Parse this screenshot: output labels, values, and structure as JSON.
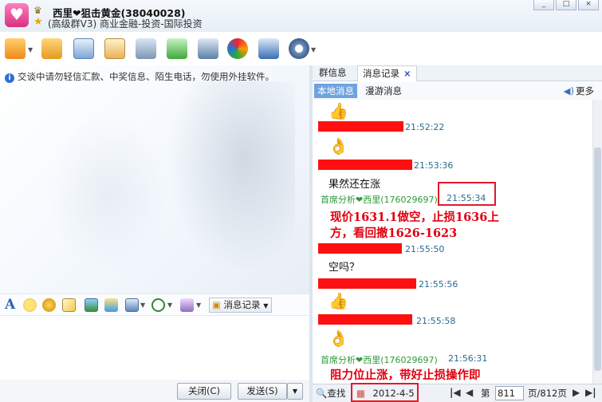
{
  "window": {
    "group_name": "西里❤狙击黄金(38040028)",
    "group_sub": "(高级群V3) 商业金融-投资-国际投资",
    "controls": [
      "_",
      "□",
      "×"
    ]
  },
  "toolbar": {
    "icons": [
      "home-icon",
      "folder-icon",
      "document-icon",
      "photo-album-icon",
      "game-icon",
      "add-app-icon",
      "tools-icon",
      "sync-icon",
      "settings-person-icon",
      "gear-icon"
    ]
  },
  "left": {
    "notice": "交谈中请勿轻信汇款、中奖信息、陌生电话，勿使用外挂软件。",
    "notice_icon": "i",
    "font_glyph": "A",
    "message_record_label": "消息记录",
    "close_label": "关闭(C)",
    "send_label": "发送(S)"
  },
  "right": {
    "tabs": [
      "群信息",
      "消息记录"
    ],
    "tab_close": "×",
    "subtabs": [
      "本地消息",
      "漫游消息"
    ],
    "more_label": "更多",
    "messages": {
      "t1": "21:52:22",
      "t2": "21:53:36",
      "m1": "果然还在涨",
      "sender1": "首席分析❤西里(176029697)",
      "t3": "21:55:34",
      "annotation1_line1": "现价1631.1做空，止损1636上",
      "annotation1_line2": "方，看回撤1626-1623",
      "t4": "21:55:50",
      "m2": "空吗？",
      "t5": "21:55:56",
      "t6": "21:55:58",
      "sender2": "首席分析❤西里(176029697)",
      "t7": "21:56:31",
      "annotation2": "阻力位止涨，带好止损操作即"
    },
    "footer": {
      "find_label": "查找",
      "date": "2012-4-5",
      "page_prefix": "第",
      "page_value": "811",
      "page_suffix": "页/812页"
    }
  },
  "colors": {
    "accent_blue": "#6da3df",
    "annotation_red": "#e00010",
    "sender_green": "#2d9b3a",
    "time_blue": "#2a6c8f"
  }
}
